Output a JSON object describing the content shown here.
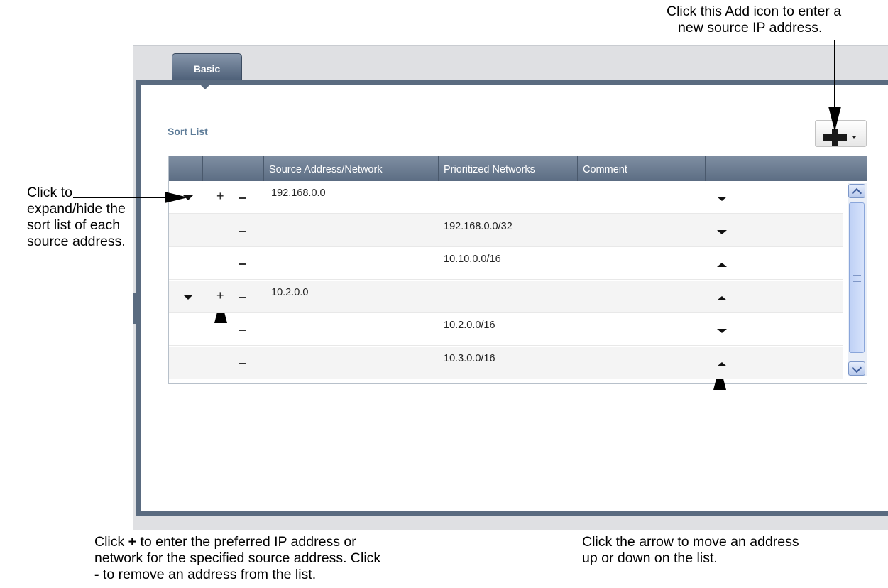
{
  "annotations": {
    "add_icon_line1": "Click this Add icon to enter a",
    "add_icon_line2": "new source IP address.",
    "expand_line1": "Click to",
    "expand_line2": "expand/hide the",
    "expand_line3": "sort list of each",
    "expand_line4": "source address.",
    "plus_line1_prefix": "Click ",
    "plus_line1_symbol": "+",
    "plus_line1_suffix": " to enter the preferred IP address or",
    "plus_line2": "network for the specified source address. Click",
    "plus_line3_symbol": "-",
    "plus_line3_suffix": " to remove an address from the list.",
    "arrow_line1": "Click the arrow to move an address",
    "arrow_line2": "up or down on the list."
  },
  "tab": {
    "label": "Basic"
  },
  "sort_list": {
    "title": "Sort List",
    "columns": [
      "Source Address/Network",
      "Prioritized Networks",
      "Comment"
    ],
    "rows": [
      {
        "source": "192.168.0.0",
        "network": "",
        "has_expander": true,
        "has_plus": true,
        "arrow": "down"
      },
      {
        "source": "",
        "network": "192.168.0.0/32",
        "has_expander": false,
        "has_plus": false,
        "arrow": "down"
      },
      {
        "source": "",
        "network": "10.10.0.0/16",
        "has_expander": false,
        "has_plus": false,
        "arrow": "up"
      },
      {
        "source": "10.2.0.0",
        "network": "",
        "has_expander": true,
        "has_plus": true,
        "arrow": "up"
      },
      {
        "source": "",
        "network": "10.2.0.0/16",
        "has_expander": false,
        "has_plus": false,
        "arrow": "down"
      },
      {
        "source": "",
        "network": "10.3.0.0/16",
        "has_expander": false,
        "has_plus": false,
        "arrow": "up"
      }
    ]
  },
  "icons": {
    "add": "plus-icon",
    "add_menu": "chevron-down-icon",
    "expand": "triangle-down-icon",
    "move_down": "arrow-down-icon",
    "move_up": "arrow-up-icon"
  }
}
